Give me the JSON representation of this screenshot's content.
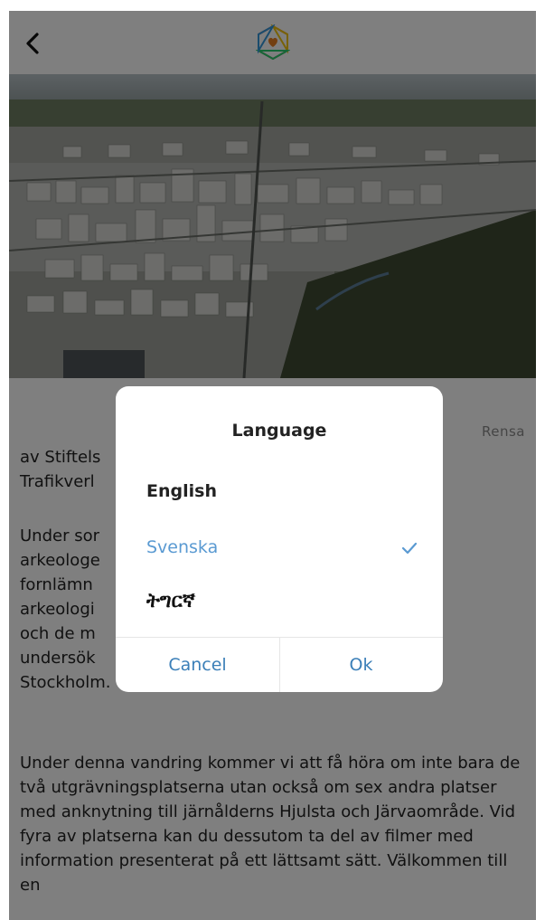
{
  "header": {
    "back_icon": "chevron-left-icon",
    "logo_icon": "hexagon-heart-logo"
  },
  "hero": {
    "description": ""
  },
  "content": {
    "clear_label": "Rensa",
    "paragraph1": "av Stiftelsen ... och Trafikverket ... d",
    "paragraph2": "Under sommaren ... arkeologer ... fornlämningar ... Dessa arkeologiska ... Trafikverket och de m... undersökningar ... Förbifart Stockholm.",
    "paragraph3": "Under denna vandring kommer vi att få höra om inte bara de två utgrävningsplatserna utan också om sex andra platser med anknytning till järnålderns Hjulsta och Järvaområde. Vid fyra av platserna kan du dessutom ta del av filmer med information presenterat på ett lättsamt sätt. Välkommen till en"
  },
  "dialog": {
    "title": "Language",
    "options": [
      {
        "label": "English",
        "selected": false
      },
      {
        "label": "Svenska",
        "selected": true
      },
      {
        "label": "ትግርኛ",
        "selected": false
      }
    ],
    "cancel_label": "Cancel",
    "ok_label": "Ok"
  },
  "colors": {
    "accent": "#5a9ad2",
    "button_text": "#3b7fb8",
    "overlay": "#000000"
  }
}
